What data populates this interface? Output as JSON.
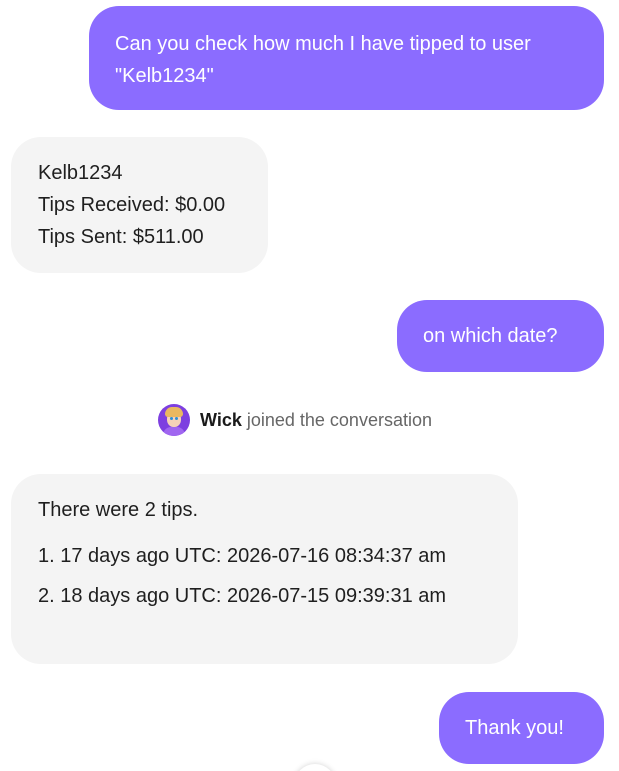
{
  "messages": {
    "user_1": "Can you check how much I have tipped to user \"Kelb1234\"",
    "agent_1": {
      "username": "Kelb1234",
      "tips_received": "Tips Received: $0.00",
      "tips_sent": "Tips Sent: $511.00"
    },
    "user_2": "on which date?",
    "join_notice": {
      "name": "Wick",
      "text": "joined the conversation"
    },
    "agent_2": {
      "intro": "There were 2 tips.",
      "items": [
        "1. 17 days ago UTC: 2026-07-16 08:34:37 am",
        "2. 18 days ago UTC: 2026-07-15 09:39:31 am"
      ]
    },
    "user_3": "Thank you!"
  },
  "colors": {
    "user_bubble": "#8b6cff",
    "agent_bubble": "#f4f4f4"
  },
  "icons": {
    "avatar": "wick-avatar-icon"
  }
}
